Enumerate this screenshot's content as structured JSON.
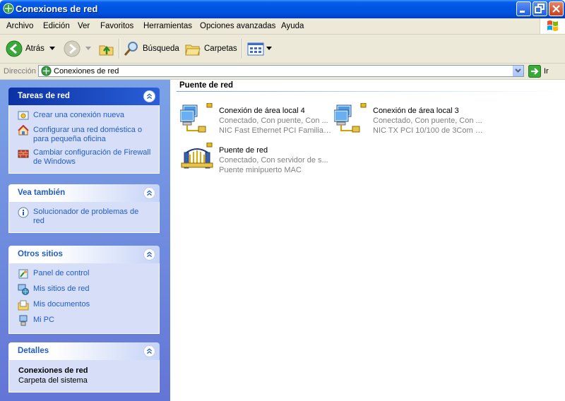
{
  "window": {
    "title": "Conexiones de red"
  },
  "menu": [
    "Archivo",
    "Edición",
    "Ver",
    "Favoritos",
    "Herramientas",
    "Opciones avanzadas",
    "Ayuda"
  ],
  "toolbar": {
    "back_label": "Atrás",
    "search_label": "Búsqueda",
    "folders_label": "Carpetas"
  },
  "address": {
    "label": "Dirección",
    "value": "Conexiones de red",
    "go_label": "Ir"
  },
  "tasks_panel": {
    "title": "Tareas de red",
    "items": [
      "Crear una conexión nueva",
      "Configurar una red doméstica o para pequeña oficina",
      "Cambiar configuración de Firewall de Windows"
    ]
  },
  "see_also_panel": {
    "title": "Vea también",
    "items": [
      "Solucionador de problemas de red"
    ]
  },
  "other_places_panel": {
    "title": "Otros sitios",
    "items": [
      "Panel de control",
      "Mis sitios de red",
      "Mis documentos",
      "Mi PC"
    ]
  },
  "details_panel": {
    "title": "Detalles",
    "name": "Conexiones de red",
    "type": "Carpeta del sistema"
  },
  "content": {
    "group_title": "Puente de red",
    "connections": [
      {
        "name": "Conexión de área local 4",
        "status": "Conectado, Con puente, Con ...",
        "device": "NIC Fast Ethernet PCI Familia ..."
      },
      {
        "name": "Conexión de área local 3",
        "status": "Conectado, Con puente, Con ...",
        "device": "NIC TX PCI 10/100 de 3Com E..."
      },
      {
        "name": "Puente de red",
        "status": "Conectado, Con servidor de s...",
        "device": "Puente minipuerto MAC"
      }
    ]
  },
  "colors": {
    "title_bar": "#0054e3",
    "task_link": "#215dc6",
    "pane_bg": "#7ba2e7"
  }
}
